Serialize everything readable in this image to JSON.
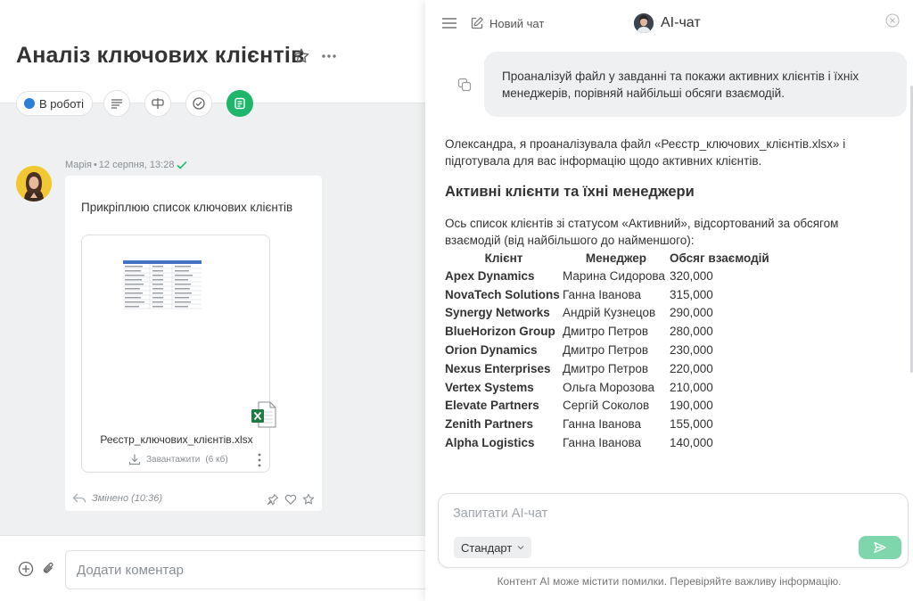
{
  "task": {
    "title": "Аналіз ключових клієнтів",
    "status_label": "В роботі"
  },
  "feed": {
    "message": {
      "author": "Марія",
      "separator": "•",
      "date": "12 серпня, 13:28",
      "text": "Прикріплюю список ключових клієнтів",
      "file_name": "Реєстр_ключових_клієнтів.xlsx",
      "download_label": "Завантажити",
      "file_size": "(6 кб)",
      "edited_label": "Змінено (10:36)"
    }
  },
  "comment": {
    "placeholder": "Додати коментар"
  },
  "ai": {
    "new_chat_label": "Новий чат",
    "title": "AI-чат",
    "user_message": "Проаналізуй файл у завданні та покажи активних клієнтів і їхніх менеджерів, порівняй найбільші обсяги взаємодій.",
    "intro": "Олександра, я проаналізувала файл «Реєстр_ключових_клієнтів.xlsx» і підготувала для вас інформацію щодо активних клієнтів.",
    "heading": "Активні клієнти та їхні менеджери",
    "description": "Ось список клієнтів зі статусом «Активний», відсортований за обсягом взаємодій (від найбільшого до найменшого):",
    "table": {
      "headers": [
        "Клієнт",
        "Менеджер",
        "Обсяг взаємодій"
      ],
      "rows": [
        [
          "Apex Dynamics",
          "Марина Сидорова",
          "320,000"
        ],
        [
          "NovaTech Solutions",
          "Ганна Іванова",
          "315,000"
        ],
        [
          "Synergy Networks",
          "Андрій Кузнецов",
          "290,000"
        ],
        [
          "BlueHorizon Group",
          "Дмитро Петров",
          "280,000"
        ],
        [
          "Orion Dynamics",
          "Дмитро Петров",
          "230,000"
        ],
        [
          "Nexus Enterprises",
          "Дмитро Петров",
          "220,000"
        ],
        [
          "Vertex Systems",
          "Ольга Морозова",
          "210,000"
        ],
        [
          "Elevate Partners",
          "Сергій Соколов",
          "190,000"
        ],
        [
          "Zenith Partners",
          "Ганна Іванова",
          "155,000"
        ],
        [
          "Alpha Logistics",
          "Ганна Іванова",
          "140,000"
        ]
      ]
    },
    "input_placeholder": "Запитати AI-чат",
    "mode_label": "Стандарт",
    "disclaimer": "Контент AI може містити помилки. Перевіряйте важливу інформацію."
  },
  "colors": {
    "accent_green": "#1db66b",
    "status_blue": "#2a7fd9",
    "send_button": "#7dd6ac"
  }
}
